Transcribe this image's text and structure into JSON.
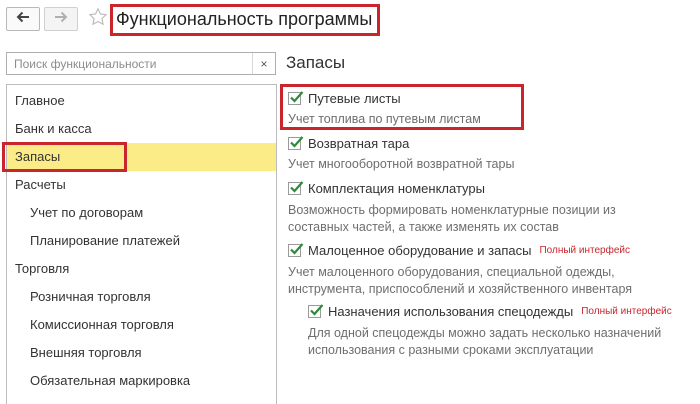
{
  "header": {
    "title": "Функциональность программы",
    "back_icon": "arrow-left-icon",
    "forward_icon": "arrow-right-icon",
    "favorite_icon": "star-icon"
  },
  "search": {
    "placeholder": "Поиск функциональности",
    "clear_label": "×"
  },
  "sidebar": {
    "items": [
      {
        "label": "Главное",
        "level": 1,
        "selected": false
      },
      {
        "label": "Банк и касса",
        "level": 1,
        "selected": false
      },
      {
        "label": "Запасы",
        "level": 1,
        "selected": true
      },
      {
        "label": "Расчеты",
        "level": 1,
        "selected": false
      },
      {
        "label": "Учет по договорам",
        "level": 2,
        "selected": false
      },
      {
        "label": "Планирование платежей",
        "level": 2,
        "selected": false
      },
      {
        "label": "Торговля",
        "level": 1,
        "selected": false
      },
      {
        "label": "Розничная торговля",
        "level": 2,
        "selected": false
      },
      {
        "label": "Комиссионная торговля",
        "level": 2,
        "selected": false
      },
      {
        "label": "Внешняя торговля",
        "level": 2,
        "selected": false
      },
      {
        "label": "Обязательная маркировка",
        "level": 2,
        "selected": false
      }
    ]
  },
  "main": {
    "section_title": "Запасы",
    "options": [
      {
        "label": "Путевые листы",
        "checked": true,
        "badge": "",
        "description": [
          "Учет топлива по путевым листам"
        ]
      },
      {
        "label": "Возвратная тара",
        "checked": true,
        "badge": "",
        "description": [
          "Учет многооборотной возвратной тары"
        ]
      },
      {
        "label": "Комплектация номенклатуры",
        "checked": true,
        "badge": "",
        "description": [
          "Возможность формировать номенклатурные позиции из",
          "составных частей, а также изменять их состав"
        ]
      },
      {
        "label": "Малоценное оборудование и запасы",
        "checked": true,
        "badge": "Полный интерфейс",
        "description": [
          "Учет малоценного оборудования, специальной одежды,",
          "инструмента, приспособлений и хозяйственного инвентаря"
        ]
      },
      {
        "label": "Назначения использования спецодежды",
        "checked": true,
        "badge": "Полный интерфейс",
        "description": [
          "Для одной спецодежды можно задать несколько назначений",
          "использования с разными сроками эксплуатации"
        ]
      }
    ]
  },
  "colors": {
    "highlight_border": "#c8252c",
    "selected_row": "#fbec88",
    "checkmark": "#2e8b3a",
    "badge_text": "#c8252c"
  }
}
